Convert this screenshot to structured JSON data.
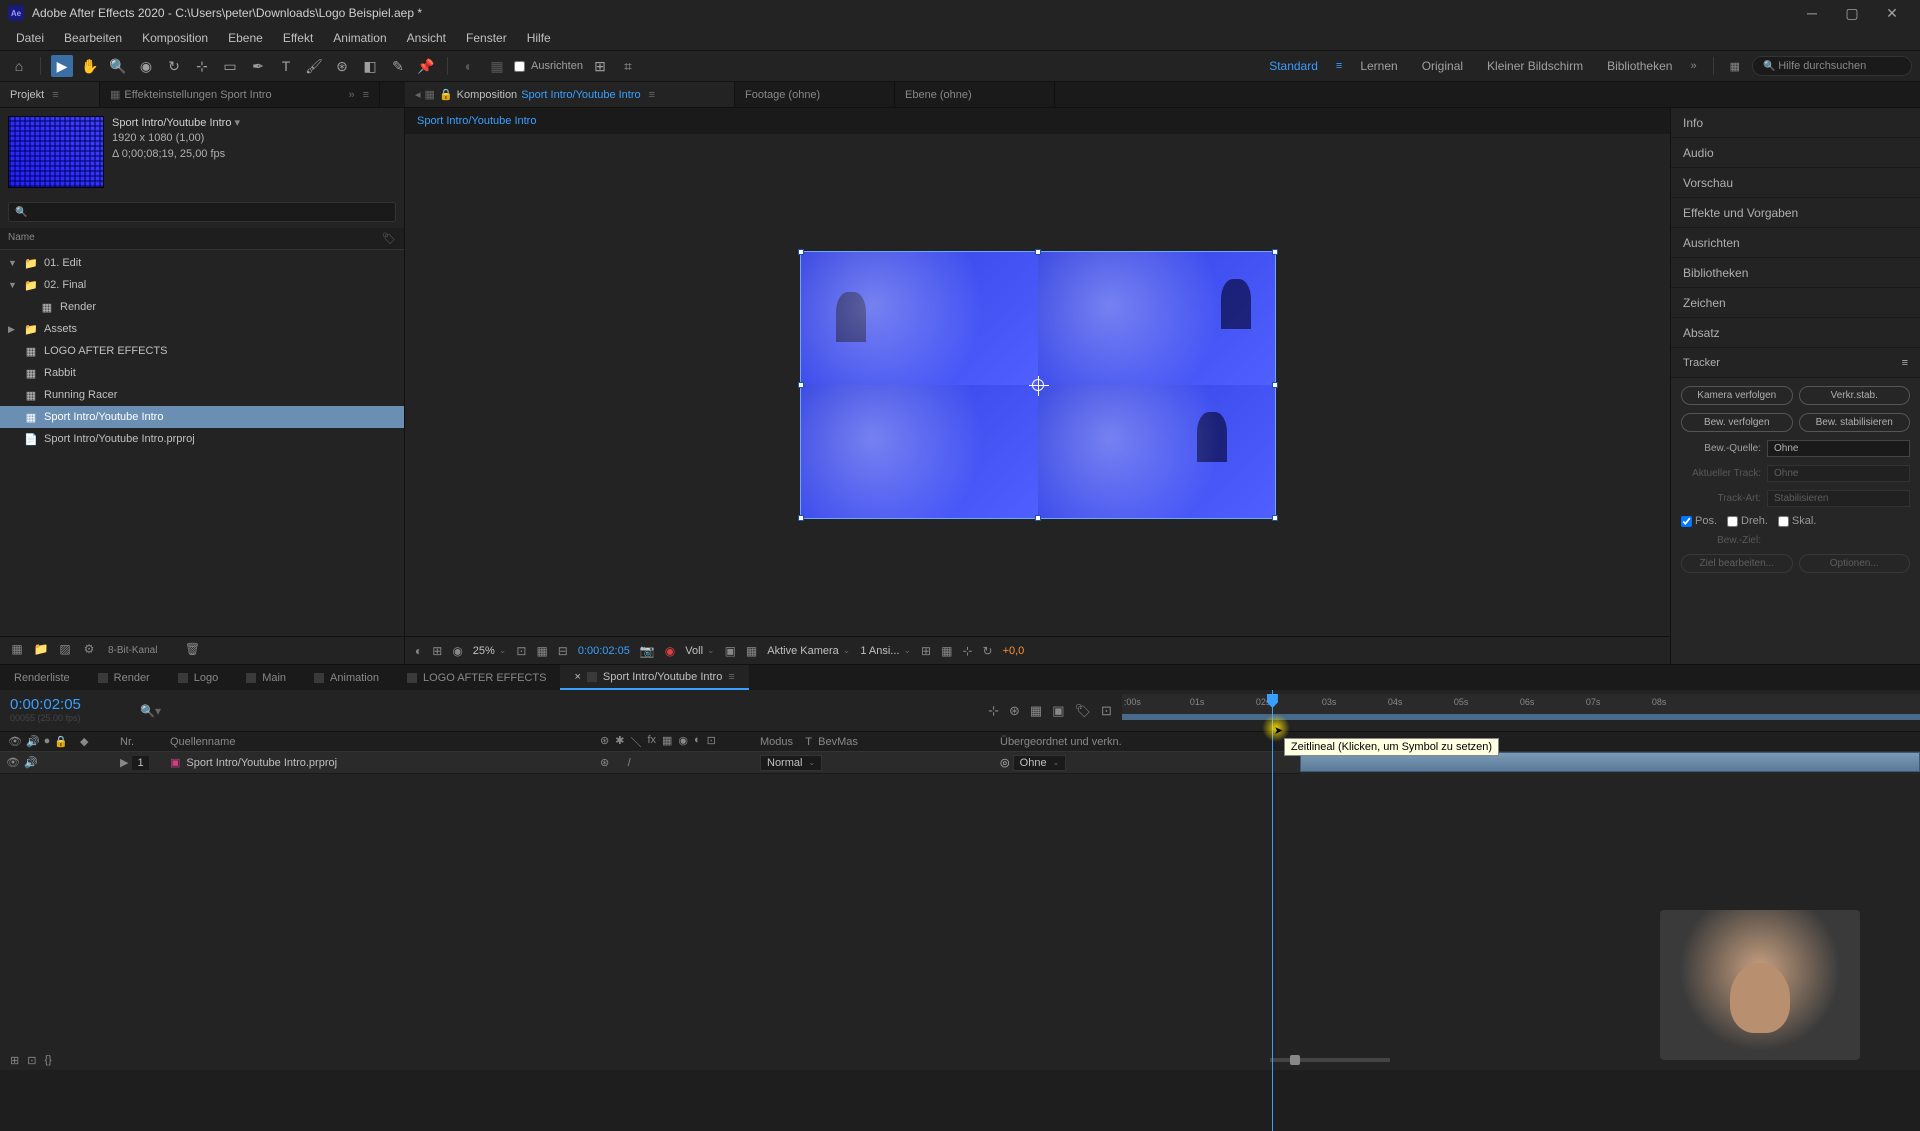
{
  "titlebar": {
    "app": "Ae",
    "title": "Adobe After Effects 2020 - C:\\Users\\peter\\Downloads\\Logo Beispiel.aep *"
  },
  "menu": [
    "Datei",
    "Bearbeiten",
    "Komposition",
    "Ebene",
    "Effekt",
    "Animation",
    "Ansicht",
    "Fenster",
    "Hilfe"
  ],
  "toolbar": {
    "align_label": "Ausrichten",
    "workspaces": [
      "Standard",
      "Lernen",
      "Original",
      "Kleiner Bildschirm",
      "Bibliotheken"
    ],
    "search_placeholder": "Hilfe durchsuchen"
  },
  "panels": {
    "project": {
      "label": "Projekt"
    },
    "effectcontrols": {
      "label": "Effekteinstellungen Sport Intro"
    },
    "composition": {
      "prefix": "Komposition",
      "name": "Sport Intro/Youtube Intro"
    },
    "footage": {
      "label": "Footage (ohne)"
    },
    "layer": {
      "label": "Ebene (ohne)"
    }
  },
  "comp_info": {
    "name": "Sport Intro/Youtube Intro",
    "res": "1920 x 1080 (1,00)",
    "dur": "Δ 0;00;08;19, 25,00 fps"
  },
  "project_tree": {
    "header": "Name",
    "items": [
      {
        "name": "01. Edit",
        "icon": "folder",
        "expanded": true,
        "indent": 0,
        "arrow": "▼"
      },
      {
        "name": "02. Final",
        "icon": "folder",
        "expanded": true,
        "indent": 0,
        "arrow": "▼"
      },
      {
        "name": "Render",
        "icon": "comp",
        "indent": 1,
        "arrow": ""
      },
      {
        "name": "Assets",
        "icon": "folder",
        "indent": 0,
        "arrow": "▶"
      },
      {
        "name": "LOGO AFTER EFFECTS",
        "icon": "comp",
        "indent": 0,
        "arrow": ""
      },
      {
        "name": "Rabbit",
        "icon": "comp",
        "indent": 0,
        "arrow": ""
      },
      {
        "name": "Running Racer",
        "icon": "comp",
        "indent": 0,
        "arrow": ""
      },
      {
        "name": "Sport Intro/Youtube Intro",
        "icon": "comp",
        "indent": 0,
        "arrow": "",
        "selected": true
      },
      {
        "name": "Sport Intro/Youtube Intro.prproj",
        "icon": "file",
        "indent": 0,
        "arrow": ""
      }
    ],
    "bit_label": "8-Bit-Kanal"
  },
  "viewer": {
    "subtab": "Sport Intro/Youtube Intro",
    "zoom": "25%",
    "time": "0:00:02:05",
    "res": "Voll",
    "camera": "Aktive Kamera",
    "views": "1 Ansi...",
    "offset": "+0,0"
  },
  "right": {
    "panels": [
      "Info",
      "Audio",
      "Vorschau",
      "Effekte und Vorgaben",
      "Ausrichten",
      "Bibliotheken",
      "Zeichen",
      "Absatz"
    ],
    "tracker": {
      "title": "Tracker",
      "btns": [
        "Kamera verfolgen",
        "Verkr.stab.",
        "Bew. verfolgen",
        "Bew. stabilisieren"
      ],
      "source_label": "Bew.-Quelle:",
      "source_value": "Ohne",
      "current_label": "Aktueller Track:",
      "current_value": "Ohne",
      "type_label": "Track-Art:",
      "type_value": "Stabilisieren",
      "pos": "Pos.",
      "rot": "Dreh.",
      "scale": "Skal.",
      "target_label": "Bew.-Ziel:",
      "edit_target": "Ziel bearbeiten...",
      "options": "Optionen..."
    }
  },
  "timeline": {
    "tabs": [
      "Renderliste",
      "Render",
      "Logo",
      "Main",
      "Animation",
      "LOGO AFTER EFFECTS",
      "Sport Intro/Youtube Intro"
    ],
    "active_tab": 6,
    "time": "0:00:02:05",
    "subtime": "00055 (25.00 fps)",
    "ruler": [
      ":00s",
      "01s",
      "02s",
      "03s",
      "04s",
      "05s",
      "06s",
      "07s",
      "08s"
    ],
    "tooltip": "Zeitlineal (Klicken, um Symbol zu setzen)",
    "columns": {
      "nr": "Nr.",
      "source": "Quellenname",
      "mode": "Modus",
      "t": "T",
      "bevmas": "BevMas",
      "parent": "Übergeordnet und verkn."
    },
    "layer": {
      "num": "1",
      "name": "Sport Intro/Youtube Intro.prproj",
      "mode": "Normal",
      "parent": "Ohne"
    }
  }
}
